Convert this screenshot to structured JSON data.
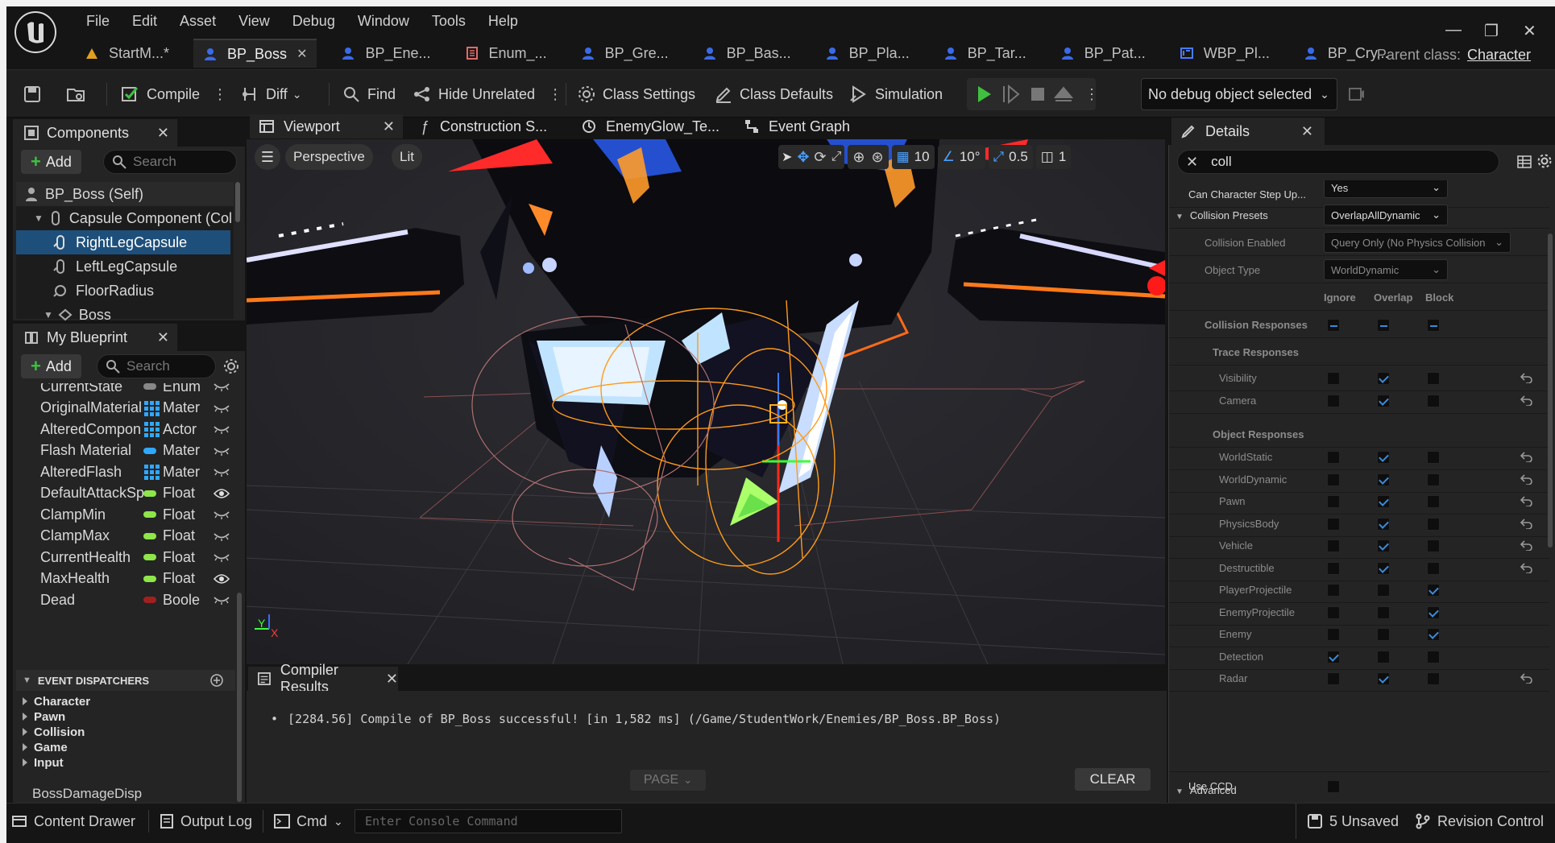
{
  "menu": [
    "File",
    "Edit",
    "Asset",
    "View",
    "Debug",
    "Window",
    "Tools",
    "Help"
  ],
  "doc_tabs": [
    {
      "label": "StartM...*",
      "active": false
    },
    {
      "label": "BP_Boss",
      "active": true
    },
    {
      "label": "BP_Ene...",
      "active": false
    },
    {
      "label": "Enum_...",
      "active": false
    },
    {
      "label": "BP_Gre...",
      "active": false
    },
    {
      "label": "BP_Bas...",
      "active": false
    },
    {
      "label": "BP_Pla...",
      "active": false
    },
    {
      "label": "BP_Tar...",
      "active": false
    },
    {
      "label": "BP_Pat...",
      "active": false
    },
    {
      "label": "WBP_Pl...",
      "active": false
    },
    {
      "label": "BP_Cry...",
      "active": false
    }
  ],
  "parent_class": {
    "label": "Parent class:",
    "value": "Character"
  },
  "toolbar": {
    "compile": "Compile",
    "diff": "Diff",
    "find": "Find",
    "hide_unrelated": "Hide Unrelated",
    "class_settings": "Class Settings",
    "class_defaults": "Class Defaults",
    "simulation": "Simulation",
    "debug_object": "No debug object selected"
  },
  "components": {
    "tab": "Components",
    "add": "Add",
    "search_placeholder": "Search",
    "items": [
      "BP_Boss (Self)",
      "Capsule Component (Col",
      "RightLegCapsule",
      "LeftLegCapsule",
      "FloorRadius",
      "Boss"
    ]
  },
  "my_blueprint": {
    "tab": "My Blueprint",
    "add": "Add",
    "search_placeholder": "Search",
    "variables": [
      {
        "name": "CurrentState",
        "type": "Enum E",
        "color": "#888888",
        "kind": "pill",
        "eye": false
      },
      {
        "name": "OriginalMaterial",
        "type": "Materia",
        "color": "#2fa8ff",
        "kind": "grid",
        "eye": false
      },
      {
        "name": "AlteredCompon",
        "type": "Actor C",
        "color": "#2fa8ff",
        "kind": "grid",
        "eye": false
      },
      {
        "name": "Flash Material",
        "type": "Materia",
        "color": "#2fa8ff",
        "kind": "pill",
        "eye": false
      },
      {
        "name": "AlteredFlash",
        "type": "Materia",
        "color": "#2fa8ff",
        "kind": "grid",
        "eye": false
      },
      {
        "name": "DefaultAttackSp",
        "type": "Float",
        "color": "#8ee64a",
        "kind": "pill",
        "eye": true
      },
      {
        "name": "ClampMin",
        "type": "Float",
        "color": "#8ee64a",
        "kind": "pill",
        "eye": false
      },
      {
        "name": "ClampMax",
        "type": "Float",
        "color": "#8ee64a",
        "kind": "pill",
        "eye": false
      },
      {
        "name": "CurrentHealth",
        "type": "Float",
        "color": "#8ee64a",
        "kind": "pill",
        "eye": false
      },
      {
        "name": "MaxHealth",
        "type": "Float",
        "color": "#8ee64a",
        "kind": "pill",
        "eye": true
      },
      {
        "name": "Dead",
        "type": "Boolea",
        "color": "#a02020",
        "kind": "pill",
        "eye": false
      }
    ],
    "event_dispatchers_label": "EVENT DISPATCHERS",
    "categories": [
      "Character",
      "Pawn",
      "Collision",
      "Game",
      "Input"
    ],
    "dispatcher_item": "BossDamageDisp"
  },
  "editor_tabs": [
    "Viewport",
    "Construction S...",
    "EnemyGlow_Te...",
    "Event Graph"
  ],
  "viewport": {
    "perspective": "Perspective",
    "lit": "Lit",
    "grid_snap": "10",
    "rot_snap": "10°",
    "scale_snap": "0.5",
    "camera_speed": "1"
  },
  "compiler": {
    "tab": "Compiler Results",
    "message": "[2284.56] Compile of BP_Boss successful! [in 1,582 ms] (/Game/StudentWork/Enemies/BP_Boss.BP_Boss)",
    "page": "PAGE",
    "clear": "CLEAR"
  },
  "details": {
    "tab": "Details",
    "search_value": "coll",
    "can_step_up_label": "Can Character Step Up...",
    "can_step_up_value": "Yes",
    "collision_presets_label": "Collision Presets",
    "collision_presets_value": "OverlapAllDynamic",
    "collision_enabled_label": "Collision Enabled",
    "collision_enabled_value": "Query Only (No Physics Collision",
    "object_type_label": "Object Type",
    "object_type_value": "WorldDynamic",
    "col_headers": [
      "Ignore",
      "Overlap",
      "Block"
    ],
    "collision_responses_label": "Collision Responses",
    "trace_responses_label": "Trace Responses",
    "trace_rows": [
      {
        "label": "Visibility",
        "value": 1
      },
      {
        "label": "Camera",
        "value": 1
      }
    ],
    "object_responses_label": "Object Responses",
    "object_rows": [
      {
        "label": "WorldStatic",
        "value": 1
      },
      {
        "label": "WorldDynamic",
        "value": 1
      },
      {
        "label": "Pawn",
        "value": 1
      },
      {
        "label": "PhysicsBody",
        "value": 1
      },
      {
        "label": "Vehicle",
        "value": 1
      },
      {
        "label": "Destructible",
        "value": 1
      },
      {
        "label": "PlayerProjectile",
        "value": 2
      },
      {
        "label": "EnemyProjectile",
        "value": 2
      },
      {
        "label": "Enemy",
        "value": 2
      },
      {
        "label": "Detection",
        "value": 0
      },
      {
        "label": "Radar",
        "value": 1
      }
    ],
    "advanced_label": "Advanced",
    "use_ccd_label": "Use CCD"
  },
  "statusbar": {
    "content_drawer": "Content Drawer",
    "output_log": "Output Log",
    "cmd": "Cmd",
    "console_placeholder": "Enter Console Command",
    "unsaved": "5 Unsaved",
    "revision_control": "Revision Control"
  }
}
